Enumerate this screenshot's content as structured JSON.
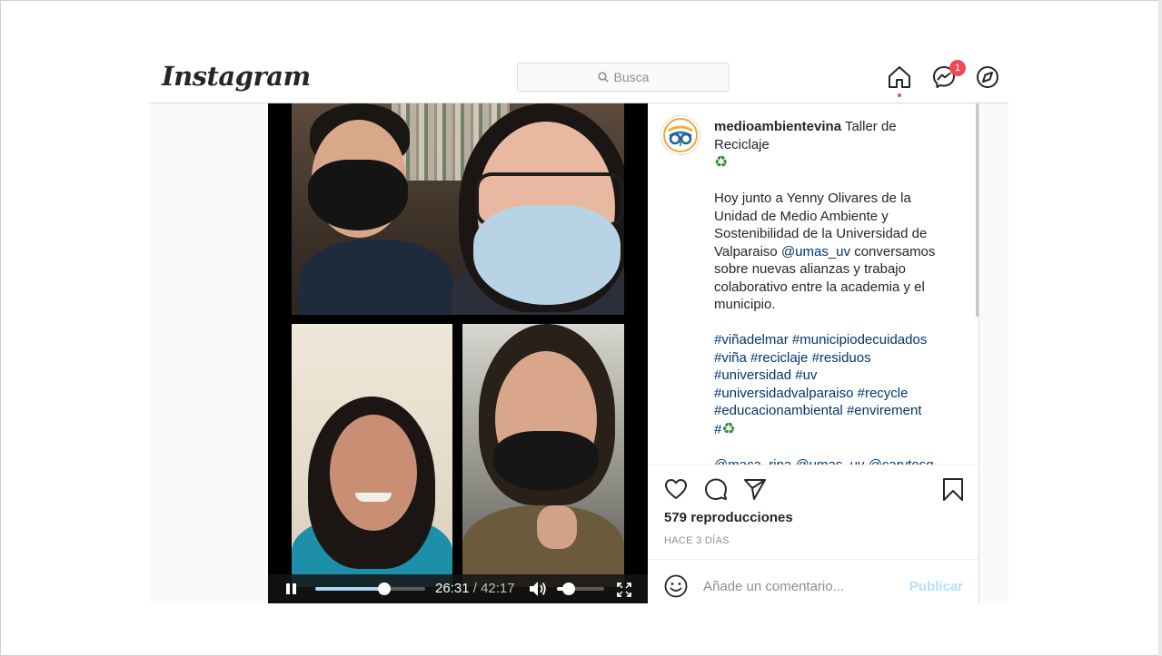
{
  "header": {
    "logo_text": "Instagram",
    "search_placeholder": "Busca",
    "messages_badge": "1"
  },
  "video": {
    "current_time": "26:31",
    "separator": "/",
    "duration": "42:17",
    "progress_fraction": 0.627,
    "volume_fraction": 0.25
  },
  "post": {
    "username": "medioambientevina",
    "title": "Taller de Reciclaje",
    "recycle_emoji": "♻",
    "body_before_mention": "Hoy junto a Yenny Olivares de la Unidad de Medio Ambiente y Sostenibilidad de la Universidad de Valparaiso ",
    "body_mention": "@umas_uv",
    "body_after_mention": " conversamos sobre nuevas alianzas y trabajo colaborativo entre la academia y el municipio.",
    "hashtags": [
      "#viñadelmar",
      "#municipiodecuidados",
      "#viña",
      "#reciclaje",
      "#residuos",
      "#universidad",
      "#uv",
      "#universidadvalparaiso",
      "#recycle",
      "#educacionambiental",
      "#envirement"
    ],
    "hashtag_emoji_prefix": "#",
    "mentions": [
      "@maca_ripa",
      "@umas_uv",
      "@carytosg"
    ],
    "views": "579 reproducciones",
    "time_ago": "HACE 3 DÍAS"
  },
  "comment": {
    "placeholder": "Añade un comentario...",
    "publish_label": "Publicar"
  },
  "colors": {
    "link": "#00376b",
    "badge": "#ed4956",
    "publish_disabled": "#b2dffc",
    "recycle_green": "#2e8b3a"
  },
  "icons": [
    "search-icon",
    "home-icon",
    "messenger-icon",
    "explore-icon",
    "pause-icon",
    "volume-icon",
    "fullscreen-icon",
    "heart-icon",
    "comment-icon",
    "share-icon",
    "bookmark-icon",
    "emoji-icon"
  ]
}
